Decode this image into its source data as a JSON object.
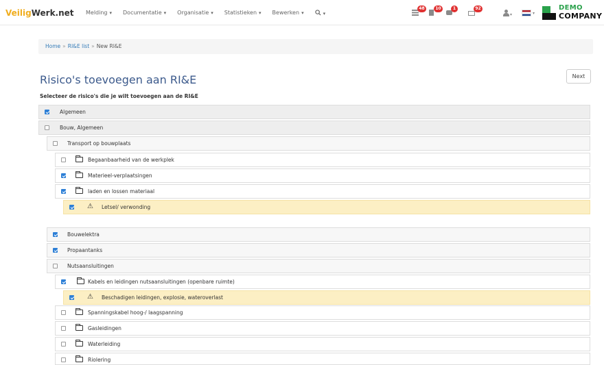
{
  "brand": {
    "part1": "Veilig",
    "part2": "Werk.net"
  },
  "nav": {
    "items": [
      {
        "label": "Melding",
        "caret": "▾"
      },
      {
        "label": "Documentatie",
        "caret": "▾"
      },
      {
        "label": "Organisatie",
        "caret": "▾"
      },
      {
        "label": "Statistieken",
        "caret": "▾"
      },
      {
        "label": "Bewerken",
        "caret": "▾"
      }
    ],
    "search_caret": "▾"
  },
  "notifications": {
    "list_count": "48",
    "doc_count": "10",
    "chat_count": "1",
    "mail_count": "92"
  },
  "logo": {
    "line1": "DEMO",
    "line2": "COMPANY"
  },
  "breadcrumb": {
    "home": "Home",
    "list": "RI&E list",
    "current": "New RI&E",
    "sep": "»"
  },
  "page": {
    "title": "Risico's toevoegen aan RI&E",
    "next_label": "Next",
    "subtitle": "Selecteer de risico's die je wilt toevoegen aan de RI&E"
  },
  "tree": [
    {
      "label": "Algemeen",
      "checked": true,
      "type": "category"
    },
    {
      "label": "Bouw, Algemeen",
      "checked": false,
      "type": "category"
    },
    {
      "label": "Transport op bouwplaats",
      "checked": false,
      "type": "subcategory"
    },
    {
      "label": "Begaanbaarheid van de werkplek",
      "checked": false,
      "type": "folder"
    },
    {
      "label": "Materieel-verplaatsingen",
      "checked": true,
      "type": "folder"
    },
    {
      "label": "laden en lossen materiaal",
      "checked": true,
      "type": "folder"
    },
    {
      "label": "Letsel/ verwonding",
      "checked": true,
      "type": "risk"
    },
    {
      "label": "Bouwelektra",
      "checked": true,
      "type": "subcategory"
    },
    {
      "label": "Propaantanks",
      "checked": true,
      "type": "subcategory"
    },
    {
      "label": "Nutsaansluitingen",
      "checked": false,
      "type": "subcategory"
    },
    {
      "label": "Kabels en leidingen nutsaansluitingen (openbare ruimte)",
      "checked": true,
      "type": "folder"
    },
    {
      "label": "Beschadigen leidingen, explosie, wateroverlast",
      "checked": true,
      "type": "risk"
    },
    {
      "label": "Spanningskabel hoog-/ laagspanning",
      "checked": false,
      "type": "folder"
    },
    {
      "label": "Gasleidingen",
      "checked": false,
      "type": "folder"
    },
    {
      "label": "Waterleiding",
      "checked": false,
      "type": "folder"
    },
    {
      "label": "Riolering",
      "checked": false,
      "type": "folder"
    }
  ],
  "colors": {
    "accent": "#2d7fd6",
    "title": "#3c5a8c",
    "warning_bg": "#fcefc4",
    "badge": "#e03131",
    "brand_orange": "#f0ad1e",
    "logo_green": "#2aa14b"
  }
}
